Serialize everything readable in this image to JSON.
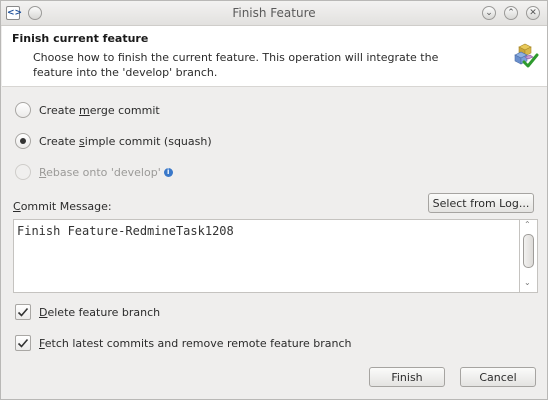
{
  "window": {
    "title": "Finish Feature",
    "app_icon_glyph": "<>",
    "controls": [
      "help",
      "minimize",
      "maximize",
      "close"
    ],
    "control_glyphs": {
      "help": "",
      "minimize": "⌄",
      "maximize": "⌃",
      "close": "✕"
    }
  },
  "header": {
    "title": "Finish current feature",
    "description": "Choose how to finish the current feature. This operation will integrate the feature into the 'develop' branch."
  },
  "options": [
    {
      "pre": "Create ",
      "mnemonic": "m",
      "post": "erge commit",
      "checked": false,
      "enabled": true
    },
    {
      "pre": "Create ",
      "mnemonic": "s",
      "post": "imple commit (squash)",
      "checked": true,
      "enabled": true
    },
    {
      "pre": "",
      "mnemonic": "R",
      "post": "ebase onto 'develop'",
      "checked": false,
      "enabled": false,
      "has_info_icon": true
    }
  ],
  "commit": {
    "label_mnemonic": "C",
    "label_rest": "ommit Message:",
    "select_button": "Select from Log...",
    "message": "Finish Feature-RedmineTask1208"
  },
  "checkboxes": [
    {
      "mnemonic": "D",
      "rest": "elete feature branch",
      "checked": true
    },
    {
      "mnemonic": "F",
      "rest": "etch latest commits and remove remote feature branch",
      "checked": true
    }
  ],
  "buttons": {
    "finish": "Finish",
    "cancel": "Cancel"
  },
  "colors": {
    "info": "#3a78c9",
    "header_bg": "#ffffff",
    "window_bg": "#efeeed"
  }
}
